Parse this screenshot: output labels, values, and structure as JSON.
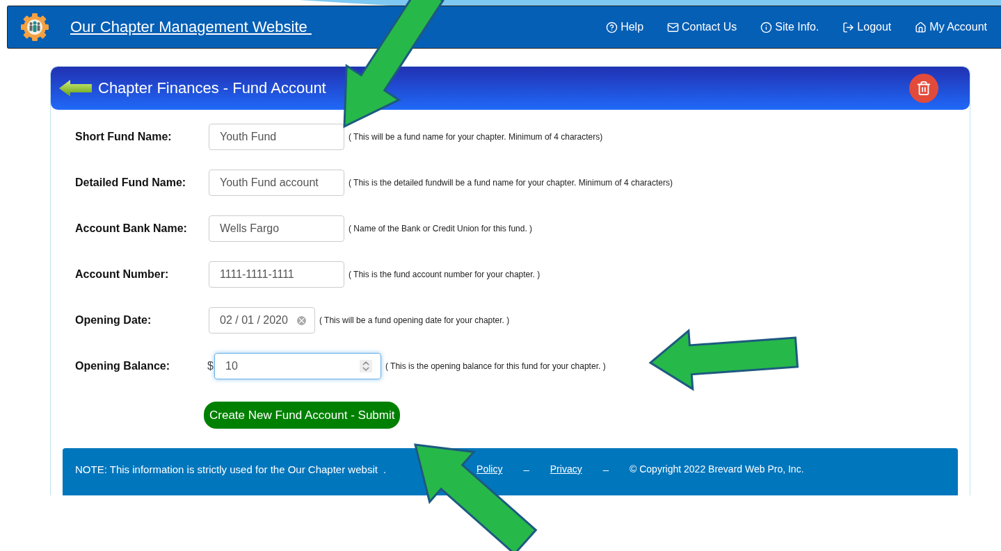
{
  "site": {
    "title": "Our Chapter Management Website ",
    "nav": [
      {
        "kind": "help",
        "label": "Help"
      },
      {
        "kind": "mail",
        "label": "Contact Us"
      },
      {
        "kind": "info",
        "label": "Site Info."
      },
      {
        "kind": "logout",
        "label": "Logout"
      },
      {
        "kind": "home",
        "label": "My Account"
      }
    ]
  },
  "panel": {
    "title": "Chapter Finances - Fund Account",
    "fields": [
      {
        "kind": "text",
        "label": "Short Fund Name:",
        "value": "Youth Fund",
        "hint": "( This will be a fund name for your chapter. Minimum of 4 characters)",
        "focused": false
      },
      {
        "kind": "text",
        "label": "Detailed Fund Name:",
        "value": "Youth Fund account",
        "hint": "( This is the detailed fundwill be a fund name for your chapter. Minimum of 4 characters)",
        "focused": false
      },
      {
        "kind": "text",
        "label": "Account Bank Name:",
        "value": "Wells Fargo",
        "hint": "( Name of the Bank or Credit Union for this fund. )",
        "focused": false
      },
      {
        "kind": "text",
        "label": "Account Number:",
        "value": "1111-1111-1111",
        "hint": "( This is the fund account number for your chapter. )",
        "focused": false
      },
      {
        "kind": "date",
        "label": "Opening Date:",
        "value": "02 / 01 / 2020",
        "hint": "( This will be a fund opening date for your chapter. )",
        "focused": false
      },
      {
        "kind": "number",
        "label": "Opening Balance:",
        "prefix": "$",
        "value": "10",
        "hint": "( This is the opening balance for this fund for your chapter. )",
        "focused": true
      }
    ],
    "submit": "Create New Fund Account - Submit",
    "footer": {
      "note": "NOTE: This information is strictly used for the Our Chapter websit",
      "dot": ".",
      "links": [
        {
          "kind": "link",
          "text": "Policy"
        },
        {
          "kind": "sep",
          "text": "–"
        },
        {
          "kind": "link",
          "text": "Privacy"
        },
        {
          "kind": "sep",
          "text": "–"
        },
        {
          "kind": "plain",
          "text": "© Copyright 2022 Brevard Web Pro, Inc."
        }
      ]
    }
  }
}
